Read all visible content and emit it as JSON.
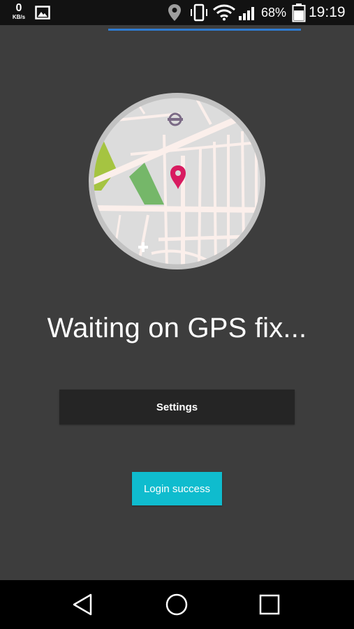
{
  "status_bar": {
    "net_speed_value": "0",
    "net_speed_unit": "KB/s",
    "battery_percent": "68%",
    "time": "19:19",
    "icons": [
      "gallery-icon",
      "location-icon",
      "vibrate-icon",
      "wifi-icon",
      "signal-icon",
      "battery-icon"
    ]
  },
  "main": {
    "status_message": "Waiting on GPS fix...",
    "settings_label": "Settings",
    "login_label": "Login success",
    "illustration": "map-pin-icon"
  },
  "colors": {
    "background": "#3d3d3d",
    "progress": "#2f7bd0",
    "login_button": "#0fbcce",
    "settings_button": "#252525",
    "pin": "#d81b60"
  },
  "nav_bar": {
    "icons": [
      "back-icon",
      "home-icon",
      "recent-apps-icon"
    ]
  }
}
